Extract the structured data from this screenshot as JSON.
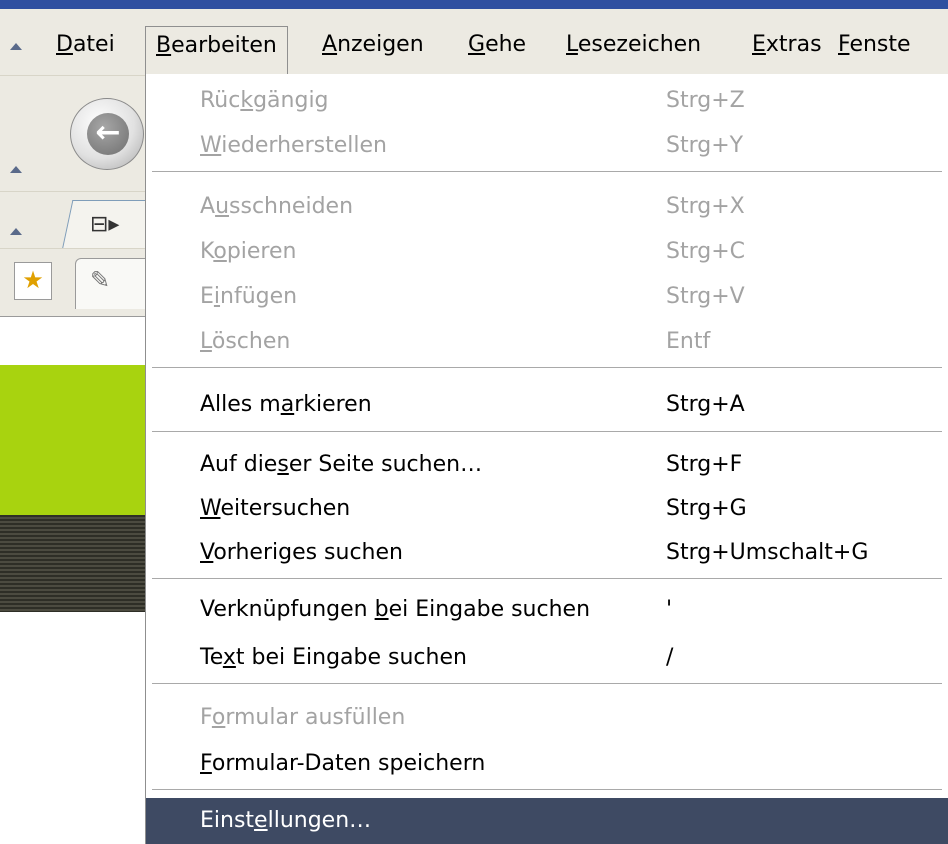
{
  "menubar": {
    "items": [
      {
        "pre": "",
        "acc": "D",
        "post": "atei"
      },
      {
        "pre": "",
        "acc": "B",
        "post": "earbeiten"
      },
      {
        "pre": "",
        "acc": "A",
        "post": "nzeigen"
      },
      {
        "pre": "",
        "acc": "G",
        "post": "ehe"
      },
      {
        "pre": "",
        "acc": "L",
        "post": "esezeichen"
      },
      {
        "pre": "",
        "acc": "E",
        "post": "xtras"
      },
      {
        "pre": "",
        "acc": "F",
        "post": "enste"
      }
    ]
  },
  "toolbar": {
    "back_icon": "back-arrow-icon",
    "tab_icon": "tab-list-icon",
    "bookmark_icon": "new-bookmark-icon",
    "pin_icon": "pin-icon"
  },
  "edit_menu": {
    "items": [
      {
        "pre": "Rüc",
        "acc": "k",
        "post": "gängig",
        "shortcut": "Strg+Z"
      },
      {
        "pre": "",
        "acc": "W",
        "post": "iederherstellen",
        "shortcut": "Strg+Y"
      },
      {
        "pre": "A",
        "acc": "u",
        "post": "sschneiden",
        "shortcut": "Strg+X"
      },
      {
        "pre": "K",
        "acc": "o",
        "post": "pieren",
        "shortcut": "Strg+C"
      },
      {
        "pre": "E",
        "acc": "i",
        "post": "nfügen",
        "shortcut": "Strg+V"
      },
      {
        "pre": "",
        "acc": "L",
        "post": "öschen",
        "shortcut": "Entf"
      },
      {
        "pre": "Alles m",
        "acc": "a",
        "post": "rkieren",
        "shortcut": "Strg+A"
      },
      {
        "pre": "Auf die",
        "acc": "s",
        "post": "er Seite suchen…",
        "shortcut": "Strg+F"
      },
      {
        "pre": "",
        "acc": "W",
        "post": "eitersuchen",
        "shortcut": "Strg+G"
      },
      {
        "pre": "",
        "acc": "V",
        "post": "orheriges suchen",
        "shortcut": "Strg+Umschalt+G"
      },
      {
        "pre": "Verknüpfungen ",
        "acc": "b",
        "post": "ei Eingabe suchen",
        "shortcut": "'"
      },
      {
        "pre": "Te",
        "acc": "x",
        "post": "t bei Eingabe suchen",
        "shortcut": "/"
      },
      {
        "pre": "F",
        "acc": "o",
        "post": "rmular ausfüllen",
        "shortcut": ""
      },
      {
        "pre": "",
        "acc": "F",
        "post": "ormular-Daten speichern",
        "shortcut": ""
      },
      {
        "pre": "Einst",
        "acc": "e",
        "post": "llungen…",
        "shortcut": ""
      }
    ]
  },
  "colors": {
    "menu_bg": "#eceae2",
    "disabled_text": "#a3a3a3",
    "selected_bg": "#3e4a63",
    "accent_green": "#a8d30f"
  }
}
